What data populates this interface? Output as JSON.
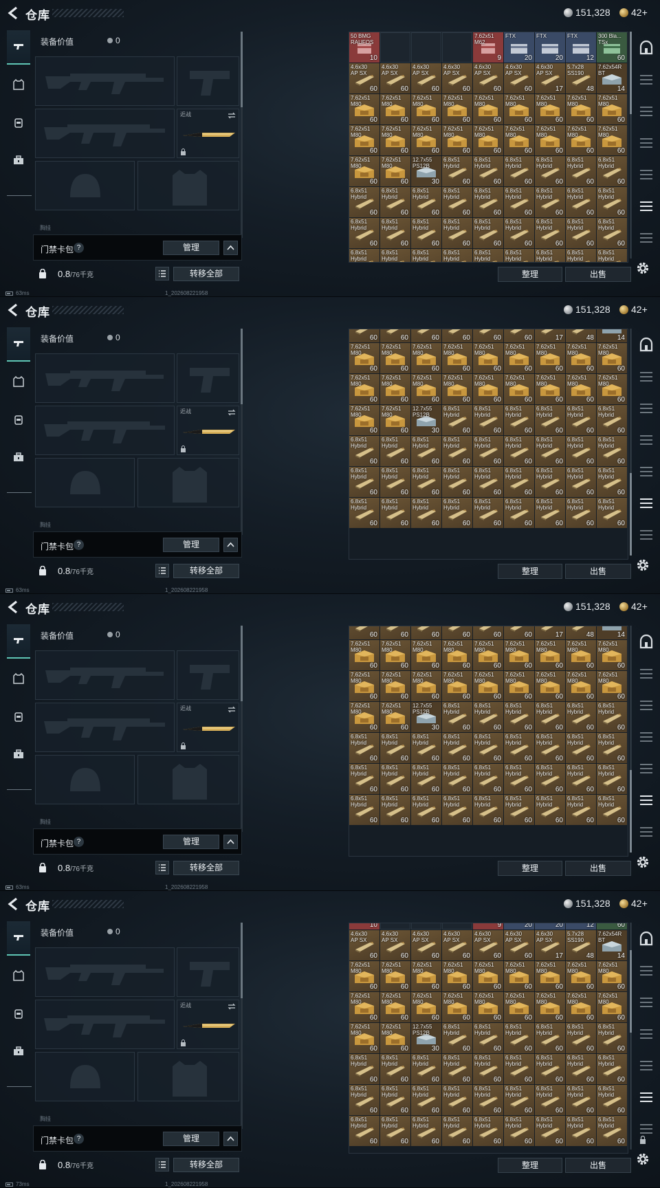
{
  "header": {
    "title": "仓库",
    "coins": "151,328",
    "tickets": "42+"
  },
  "nav": {
    "items": [
      "pistol",
      "armor",
      "backpack",
      "toolbox"
    ]
  },
  "equipment": {
    "value_label": "装备价值",
    "value": "0",
    "melee_label": "近战",
    "more_label": "胸挂"
  },
  "keycard": {
    "label": "门禁卡包",
    "help": "?",
    "manage": "管理"
  },
  "weight": {
    "current": "0.8",
    "max": "/76千克"
  },
  "buttons": {
    "transfer_all": "转移全部",
    "sort": "整理",
    "sell": "出售"
  },
  "status": [
    "63ms",
    "63ms",
    "63ms",
    "73ms"
  ],
  "build": "1_202608221958",
  "stash": {
    "row_top": [
      {
        "name": "50 BMG\nRAUFOS",
        "qty": "10",
        "kind": "red"
      },
      {
        "name": "",
        "qty": "",
        "kind": "empty"
      },
      {
        "name": "",
        "qty": "",
        "kind": "empty"
      },
      {
        "name": "",
        "qty": "",
        "kind": "empty"
      },
      {
        "name": "7.62x51\nM62",
        "qty": "9",
        "kind": "red"
      },
      {
        "name": "FTX",
        "qty": "20",
        "kind": "blue"
      },
      {
        "name": "FTX",
        "qty": "20",
        "kind": "blue"
      },
      {
        "name": "FTX",
        "qty": "12",
        "kind": "blue"
      },
      {
        "name": "300 Bla...\nTSx",
        "qty": "60",
        "kind": "green"
      }
    ],
    "row_46": [
      {
        "name": "4.6x30\nAP SX",
        "qty": "60",
        "kind": "bullet"
      },
      {
        "name": "4.6x30\nAP SX",
        "qty": "60",
        "kind": "bullet"
      },
      {
        "name": "4.6x30\nAP SX",
        "qty": "60",
        "kind": "bullet"
      },
      {
        "name": "4.6x30\nAP SX",
        "qty": "60",
        "kind": "bullet"
      },
      {
        "name": "4.6x30\nAP SX",
        "qty": "60",
        "kind": "bullet"
      },
      {
        "name": "4.6x30\nAP SX",
        "qty": "60",
        "kind": "bullet"
      },
      {
        "name": "4.6x30\nAP SX",
        "qty": "17",
        "kind": "bullet"
      },
      {
        "name": "5.7x28\nSS190",
        "qty": "48",
        "kind": "bullet"
      },
      {
        "name": "7.62x54R\nBT",
        "qty": "14",
        "kind": "steel"
      }
    ],
    "row_762a": [
      {
        "name": "7.62x51\nM80",
        "qty": "60",
        "kind": "box"
      },
      {
        "name": "7.62x51\nM80",
        "qty": "60",
        "kind": "box"
      },
      {
        "name": "7.62x51\nM80",
        "qty": "60",
        "kind": "box"
      },
      {
        "name": "7.62x51\nM80",
        "qty": "60",
        "kind": "box"
      },
      {
        "name": "7.62x51\nM80",
        "qty": "60",
        "kind": "box"
      },
      {
        "name": "7.62x51\nM80",
        "qty": "60",
        "kind": "box"
      },
      {
        "name": "7.62x51\nM80",
        "qty": "60",
        "kind": "box"
      },
      {
        "name": "7.62x51\nM80",
        "qty": "60",
        "kind": "box"
      },
      {
        "name": "7.62x51\nM80",
        "qty": "60",
        "kind": "box"
      }
    ],
    "row_762b": [
      {
        "name": "7.62x51\nM80",
        "qty": "60",
        "kind": "box"
      },
      {
        "name": "7.62x51\nM80",
        "qty": "60",
        "kind": "box"
      },
      {
        "name": "7.62x51\nM80",
        "qty": "60",
        "kind": "box"
      },
      {
        "name": "7.62x51\nM80",
        "qty": "60",
        "kind": "box"
      },
      {
        "name": "7.62x51\nM80",
        "qty": "60",
        "kind": "box"
      },
      {
        "name": "7.62x51\nM80",
        "qty": "60",
        "kind": "box"
      },
      {
        "name": "7.62x51\nM80",
        "qty": "60",
        "kind": "box"
      },
      {
        "name": "7.62x51\nM80",
        "qty": "60",
        "kind": "box"
      },
      {
        "name": "7.62x51\nM80",
        "qty": "60",
        "kind": "box"
      }
    ],
    "row_mixed": [
      {
        "name": "7.62x51\nM80",
        "qty": "60",
        "kind": "box"
      },
      {
        "name": "7.62x51\nM80",
        "qty": "60",
        "kind": "box"
      },
      {
        "name": "12.7x55\nPS12B",
        "qty": "30",
        "kind": "steel"
      },
      {
        "name": "6.8x51\nHybrid",
        "qty": "60",
        "kind": "bullet"
      },
      {
        "name": "6.8x51\nHybrid",
        "qty": "60",
        "kind": "bullet"
      },
      {
        "name": "6.8x51\nHybrid",
        "qty": "60",
        "kind": "bullet"
      },
      {
        "name": "6.8x51\nHybrid",
        "qty": "60",
        "kind": "bullet"
      },
      {
        "name": "6.8x51\nHybrid",
        "qty": "60",
        "kind": "bullet"
      },
      {
        "name": "6.8x51\nHybrid",
        "qty": "60",
        "kind": "bullet"
      }
    ],
    "row_68": [
      {
        "name": "6.8x51\nHybrid",
        "qty": "60",
        "kind": "bullet"
      },
      {
        "name": "6.8x51\nHybrid",
        "qty": "60",
        "kind": "bullet"
      },
      {
        "name": "6.8x51\nHybrid",
        "qty": "60",
        "kind": "bullet"
      },
      {
        "name": "6.8x51\nHybrid",
        "qty": "60",
        "kind": "bullet"
      },
      {
        "name": "6.8x51\nHybrid",
        "qty": "60",
        "kind": "bullet"
      },
      {
        "name": "6.8x51\nHybrid",
        "qty": "60",
        "kind": "bullet"
      },
      {
        "name": "6.8x51\nHybrid",
        "qty": "60",
        "kind": "bullet"
      },
      {
        "name": "6.8x51\nHybrid",
        "qty": "60",
        "kind": "bullet"
      },
      {
        "name": "6.8x51\nHybrid",
        "qty": "60",
        "kind": "bullet"
      }
    ]
  },
  "frames": [
    {
      "rows": [
        "row_top",
        "row_46",
        "row_762a",
        "row_762b",
        "row_mixed",
        "row_68",
        "row_68",
        "row_68"
      ],
      "offset": 0,
      "scroll": 0,
      "bottom_lock": false
    },
    {
      "rows": [
        "row_46",
        "row_762a",
        "row_762b",
        "row_mixed",
        "row_68",
        "row_68",
        "row_68"
      ],
      "offset": -25,
      "scroll": 210,
      "bottom_lock": false
    },
    {
      "rows": [
        "row_46",
        "row_762a",
        "row_762b",
        "row_mixed",
        "row_68",
        "row_68",
        "row_68"
      ],
      "offset": -25,
      "scroll": 210,
      "bottom_lock": false
    },
    {
      "rows": [
        "row_top",
        "row_46",
        "row_762a",
        "row_762b",
        "row_mixed",
        "row_68",
        "row_68",
        "row_68"
      ],
      "offset": -35,
      "scroll": 40,
      "bottom_lock": true
    }
  ],
  "colors": {
    "accent": "#5fc6b5",
    "cell_red": "#8a3a3a",
    "cell_blue": "#3a4a66",
    "cell_green": "#3a5a40",
    "cell_gold": "#6b5535",
    "cell_gold_dark": "#4e3d27"
  }
}
